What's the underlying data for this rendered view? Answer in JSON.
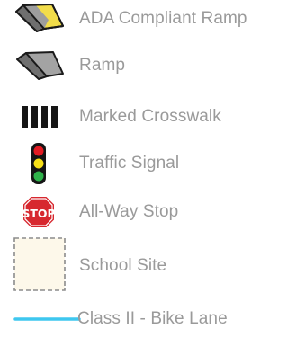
{
  "legend": {
    "items": [
      {
        "label": "ADA Compliant Ramp",
        "icon": "ada-ramp-icon"
      },
      {
        "label": "Ramp",
        "icon": "ramp-icon"
      },
      {
        "label": "Marked Crosswalk",
        "icon": "crosswalk-icon"
      },
      {
        "label": "Traffic Signal",
        "icon": "traffic-signal-icon"
      },
      {
        "label": "All-Way Stop",
        "icon": "stop-sign-icon",
        "sign_text": "STOP"
      },
      {
        "label": "School Site",
        "icon": "school-site-icon"
      },
      {
        "label": "Class II - Bike Lane",
        "icon": "bike-lane-icon"
      }
    ]
  },
  "colors": {
    "label_text": "#9a9a9a",
    "ramp_gray": "#9d9d9d",
    "ada_yellow": "#f2dd4a",
    "stop_red": "#d7282f",
    "signal_red": "#e31b23",
    "signal_yellow": "#f7e017",
    "signal_green": "#2fb24a",
    "school_fill": "#fdf8ea",
    "bike_lane_blue": "#3ec7ef"
  }
}
